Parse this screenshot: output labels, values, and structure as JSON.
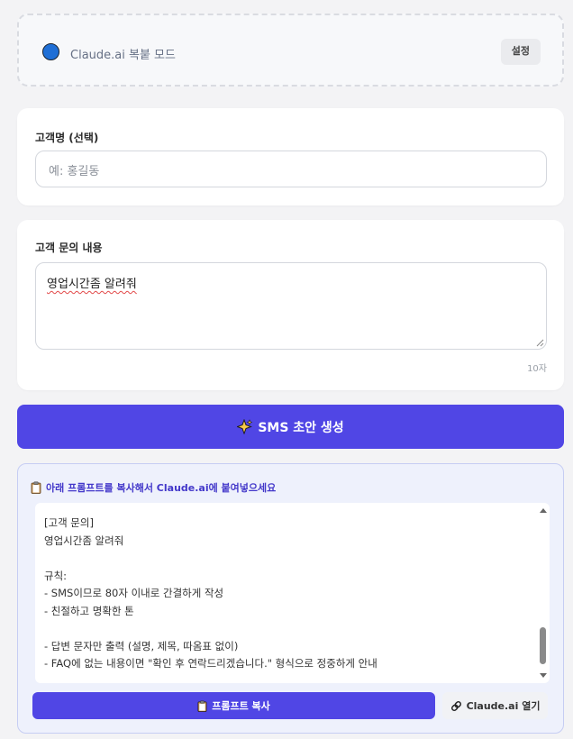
{
  "mode": {
    "label": "Claude.ai 복붙 모드",
    "settings_label": "설정",
    "dot_color": "#1f6fd6"
  },
  "customer": {
    "label": "고객명 (선택)",
    "placeholder": "예: 홍길동",
    "value": ""
  },
  "inquiry": {
    "label": "고객 문의 내용",
    "value": "영업시간좀 알려줘",
    "char_count": "10자"
  },
  "generate": {
    "label": "SMS 초안 생성",
    "icon": "sparkles-icon"
  },
  "prompt": {
    "header": "아래 프롬프트를 복사해서 Claude.ai에 붙여넣으세요",
    "lines": [
      "[고객 문의]",
      "영업시간좀 알려줘",
      "",
      "규칙:",
      "- SMS이므로 80자 이내로 간결하게 작성",
      "- 친절하고 명확한 톤",
      "",
      "- 답변 문자만 출력 (설명, 제목, 따옴표 없이)",
      "- FAQ에 없는 내용이면 \"확인 후 연락드리겠습니다.\" 형식으로 정중하게 안내"
    ],
    "copy_label": "프롬프트 복사",
    "open_label": "Claude.ai 열기"
  },
  "colors": {
    "accent": "#5046e5",
    "accent_text": "#4338ca",
    "panel_bg": "#eef1fc"
  }
}
